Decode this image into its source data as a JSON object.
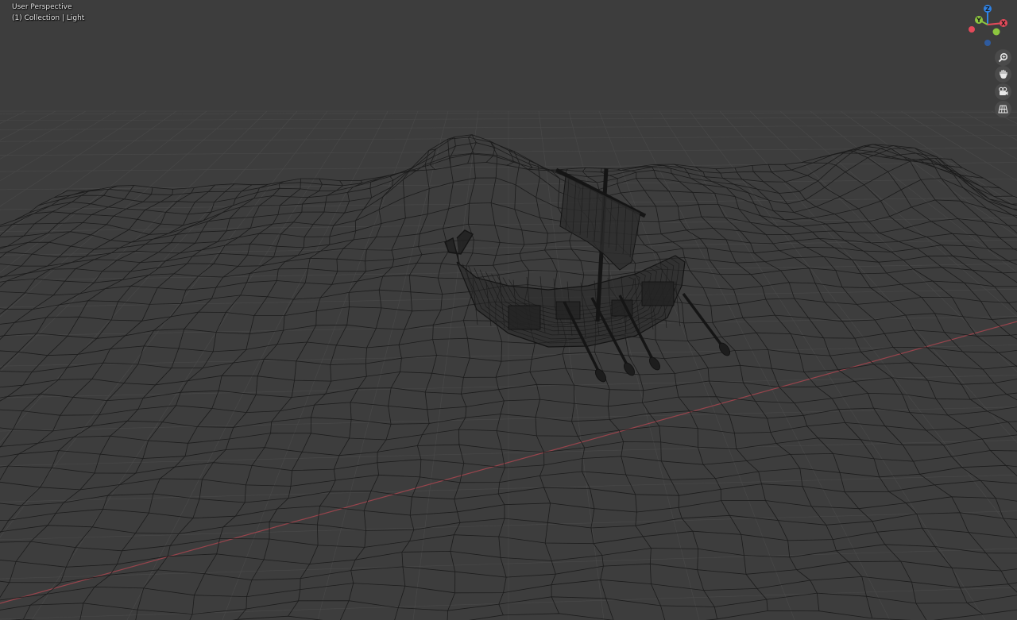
{
  "viewport": {
    "view_name": "User Perspective",
    "collection_info": "(1) Collection | Light"
  },
  "gizmo": {
    "axes": [
      {
        "name": "Z",
        "label": "Z",
        "color": "#2f83e6",
        "positive": true
      },
      {
        "name": "Y",
        "label": "Y",
        "color": "#8cc63f",
        "positive": true
      },
      {
        "name": "X",
        "label": "X",
        "color": "#e44a5a",
        "positive": true
      },
      {
        "name": "-X",
        "label": "",
        "color": "#e44a5a",
        "positive": false
      },
      {
        "name": "-Y",
        "label": "",
        "color": "#8cc63f",
        "positive": false
      },
      {
        "name": "-Z",
        "label": "",
        "color": "#2f83e6",
        "positive": false
      }
    ]
  },
  "nav_buttons": [
    {
      "id": "zoom",
      "icon": "zoom-icon"
    },
    {
      "id": "pan",
      "icon": "hand-pan-icon"
    },
    {
      "id": "camera",
      "icon": "camera-view-icon"
    },
    {
      "id": "ortho",
      "icon": "grid-perspective-toggle-icon"
    }
  ],
  "colors": {
    "background": "#3d3d3d",
    "grid": "#4a4a4a",
    "wire": "#1c1c1c",
    "x_axis": "#a8464f"
  }
}
